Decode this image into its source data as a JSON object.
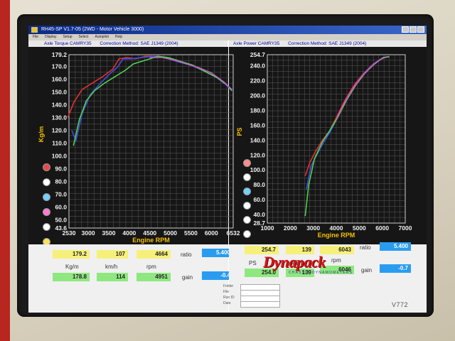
{
  "window": {
    "title": "RH45-SP V1.7-05   (2WD - Motor Vehicle 3000)"
  },
  "menu": [
    "File",
    "Display",
    "Setup",
    "Select",
    "Autopilot",
    "Help"
  ],
  "left_chart": {
    "title": "Axle Torque  CAMRY35",
    "method": "Correction Method: SAE J1349 (2004)",
    "ylabel": "Kg/m",
    "xlabel": "Engine RPM",
    "x_ticks": [
      "2530",
      "3000",
      "3500",
      "4000",
      "4500",
      "5000",
      "5500",
      "6000",
      "6532"
    ],
    "y_ticks": [
      "179.2",
      "170.0",
      "160.0",
      "150.0",
      "140.0",
      "130.0",
      "120.0",
      "110.0",
      "100.0",
      "90.0",
      "80.0",
      "70.0",
      "60.0",
      "50.0",
      "43.6"
    ]
  },
  "right_chart": {
    "title": "Axle Power  CAMRY35",
    "method": "Correction Method: SAE J1349 (2004)",
    "ylabel": "PS",
    "xlabel": "Engine RPM",
    "x_ticks": [
      "1000",
      "2000",
      "3000",
      "4000",
      "5000",
      "6000",
      "7000"
    ],
    "y_ticks": [
      "254.7",
      "240.0",
      "220.0",
      "200.0",
      "180.0",
      "160.0",
      "140.0",
      "120.0",
      "100.0",
      "80.0",
      "60.0",
      "40.0",
      "28.7"
    ]
  },
  "chart_data": [
    {
      "type": "line",
      "title": "Axle Torque  CAMRY35",
      "xlabel": "Engine RPM",
      "ylabel": "Kg/m",
      "xlim": [
        2530,
        6532
      ],
      "ylim": [
        43.6,
        179.2
      ],
      "grid": true,
      "series": [
        {
          "color": "#e53030",
          "x": [
            2500,
            2650,
            2850,
            3100,
            3350,
            3600,
            3750,
            3950,
            4150,
            4400,
            4700,
            4900,
            5200,
            5500,
            5800,
            6100,
            6350,
            6500
          ],
          "y": [
            130,
            142,
            152,
            157,
            162,
            168,
            176,
            177,
            176,
            178,
            178,
            177,
            174,
            171,
            167,
            162,
            156,
            151
          ]
        },
        {
          "color": "#4050e0",
          "x": [
            2600,
            2700,
            2850,
            3050,
            3300,
            3550,
            3700,
            3850,
            4050,
            4300,
            4600,
            4850,
            5150,
            5500,
            5800,
            6100,
            6350,
            6500
          ],
          "y": [
            120,
            112,
            133,
            148,
            157,
            165,
            169,
            176,
            176,
            177,
            178,
            177,
            174,
            171,
            167,
            162,
            156,
            151
          ]
        },
        {
          "color": "#50d050",
          "x": [
            2640,
            2780,
            2950,
            3150,
            3400,
            3650,
            3900,
            4100,
            4400,
            4700,
            4950,
            5250,
            5550,
            5850,
            6150,
            6400,
            6500
          ],
          "y": [
            108,
            128,
            143,
            151,
            157,
            162,
            167,
            172,
            175,
            178,
            177,
            174,
            171,
            166,
            161,
            155,
            151
          ]
        },
        {
          "color": "#c060c0",
          "x": [
            4500,
            4800,
            5100,
            5400,
            5700,
            6000,
            6300,
            6500
          ],
          "y": [
            177,
            177,
            175,
            172,
            169,
            165,
            158,
            152
          ]
        }
      ]
    },
    {
      "type": "line",
      "title": "Axle Power  CAMRY35",
      "xlabel": "Engine RPM",
      "ylabel": "PS",
      "xlim": [
        1000,
        7000
      ],
      "ylim": [
        28.7,
        254.7
      ],
      "grid": true,
      "series": [
        {
          "color": "#e53030",
          "x": [
            2650,
            2850,
            3100,
            3400,
            3700,
            4000,
            4400,
            4800,
            5200,
            5600,
            6000,
            6300
          ],
          "y": [
            92,
            110,
            125,
            140,
            152,
            170,
            195,
            215,
            230,
            242,
            250,
            252
          ]
        },
        {
          "color": "#4050e0",
          "x": [
            2700,
            2900,
            3150,
            3450,
            3750,
            4050,
            4450,
            4850,
            5250,
            5650,
            6050,
            6300
          ],
          "y": [
            74,
            105,
            120,
            137,
            152,
            170,
            196,
            215,
            231,
            243,
            251,
            252
          ]
        },
        {
          "color": "#50d050",
          "x": [
            2650,
            2800,
            3050,
            3400,
            3700,
            4050,
            4450,
            4850,
            5250,
            5650,
            6050,
            6300
          ],
          "y": [
            38,
            80,
            115,
            138,
            152,
            170,
            194,
            214,
            230,
            242,
            251,
            252
          ]
        },
        {
          "color": "#c060c0",
          "x": [
            4000,
            4300,
            4700,
            5100,
            5500,
            5900,
            6200
          ],
          "y": [
            168,
            187,
            208,
            225,
            238,
            248,
            252
          ]
        }
      ]
    }
  ],
  "series_dots": [
    "#e84a4a",
    "#ffffff",
    "#70d0ff",
    "#ff7ad0",
    "#ffffff",
    "#f6e060"
  ],
  "right_series_dots": [
    "#ff8a8a",
    "#ffffff",
    "#70d0ff",
    "#ffffff",
    "#ffffff",
    "#ffffff"
  ],
  "left_panel": {
    "row1": [
      "179.2",
      "107",
      "4664"
    ],
    "ratio_label": "ratio",
    "ratio_value": "5.400",
    "units": [
      "Kg/m",
      "km/h",
      "rpm"
    ],
    "row2": [
      "178.8",
      "114",
      "4951"
    ],
    "gain_label": "gain",
    "gain_value": "-0.4"
  },
  "right_panel": {
    "row1": [
      "254.7",
      "139",
      "6043"
    ],
    "ratio_label": "ratio",
    "ratio_value": "5.400",
    "units": [
      "PS",
      "km/h",
      "rpm"
    ],
    "row2": [
      "254.0",
      "139",
      "6046"
    ],
    "gain_label": "gain",
    "gain_value": "-0.7"
  },
  "info_fields": [
    {
      "label": "Folder",
      "value": ""
    },
    {
      "label": "File",
      "value": ""
    },
    {
      "label": "Run ID",
      "value": ""
    },
    {
      "label": "Date",
      "value": ""
    }
  ],
  "logo": {
    "text": "Dynapack",
    "sub": "CHASSIS DYNAMOMETERS"
  },
  "monitor": {
    "model": "V772"
  }
}
